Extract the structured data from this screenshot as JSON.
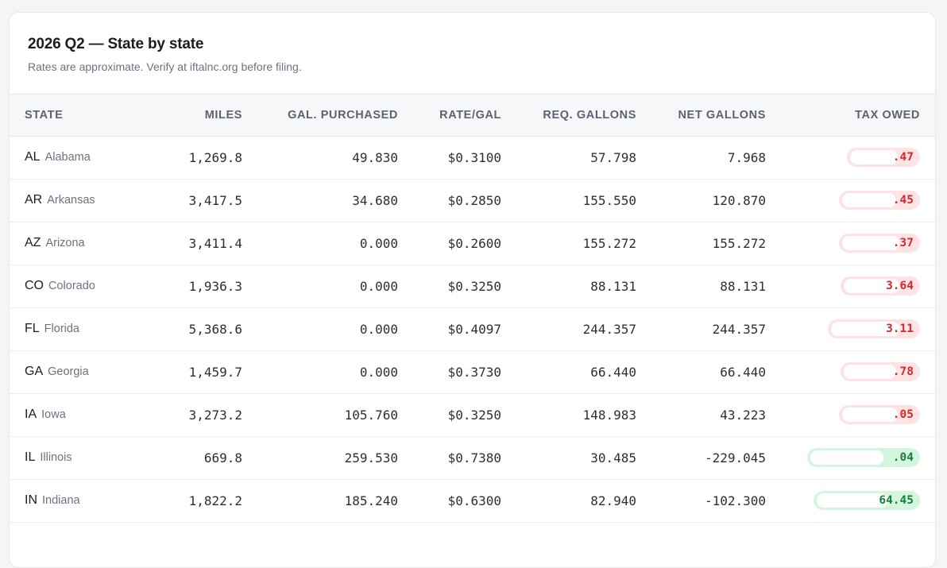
{
  "card": {
    "title": "2026 Q2 — State by state",
    "subtitle": "Rates are approximate. Verify at iftalnc.org before filing."
  },
  "table": {
    "headers": {
      "state": "STATE",
      "miles": "MILES",
      "gal_purchased": "GAL. PURCHASED",
      "rate": "RATE/GAL",
      "req_gallons": "REQ. GALLONS",
      "net_gallons": "NET GALLONS",
      "tax_owed": "TAX OWED"
    },
    "rows": [
      {
        "code": "AL",
        "name": "Alabama",
        "miles": "1,269.8",
        "gal_purchased": "49.830",
        "rate": "$0.3100",
        "req_gallons": "57.798",
        "net_gallons": "7.968",
        "tax_owed": ".47",
        "status": "owe"
      },
      {
        "code": "AR",
        "name": "Arkansas",
        "miles": "3,417.5",
        "gal_purchased": "34.680",
        "rate": "$0.2850",
        "req_gallons": "155.550",
        "net_gallons": "120.870",
        "tax_owed": ".45",
        "status": "owe"
      },
      {
        "code": "AZ",
        "name": "Arizona",
        "miles": "3,411.4",
        "gal_purchased": "0.000",
        "rate": "$0.2600",
        "req_gallons": "155.272",
        "net_gallons": "155.272",
        "tax_owed": ".37",
        "status": "owe"
      },
      {
        "code": "CO",
        "name": "Colorado",
        "miles": "1,936.3",
        "gal_purchased": "0.000",
        "rate": "$0.3250",
        "req_gallons": "88.131",
        "net_gallons": "88.131",
        "tax_owed": "3.64",
        "status": "owe"
      },
      {
        "code": "FL",
        "name": "Florida",
        "miles": "5,368.6",
        "gal_purchased": "0.000",
        "rate": "$0.4097",
        "req_gallons": "244.357",
        "net_gallons": "244.357",
        "tax_owed": "3.11",
        "status": "owe"
      },
      {
        "code": "GA",
        "name": "Georgia",
        "miles": "1,459.7",
        "gal_purchased": "0.000",
        "rate": "$0.3730",
        "req_gallons": "66.440",
        "net_gallons": "66.440",
        "tax_owed": ".78",
        "status": "owe"
      },
      {
        "code": "IA",
        "name": "Iowa",
        "miles": "3,273.2",
        "gal_purchased": "105.760",
        "rate": "$0.3250",
        "req_gallons": "148.983",
        "net_gallons": "43.223",
        "tax_owed": ".05",
        "status": "owe"
      },
      {
        "code": "IL",
        "name": "Illinois",
        "miles": "669.8",
        "gal_purchased": "259.530",
        "rate": "$0.7380",
        "req_gallons": "30.485",
        "net_gallons": "-229.045",
        "tax_owed": ".04",
        "status": "credit"
      },
      {
        "code": "IN",
        "name": "Indiana",
        "miles": "1,822.2",
        "gal_purchased": "185.240",
        "rate": "$0.6300",
        "req_gallons": "82.940",
        "net_gallons": "-102.300",
        "tax_owed": "64.45",
        "status": "credit"
      }
    ]
  },
  "colors": {
    "owe_text": "#d12b2b",
    "owe_bg": "#fde3e3",
    "credit_text": "#17803d",
    "credit_bg": "#d6f5df"
  }
}
